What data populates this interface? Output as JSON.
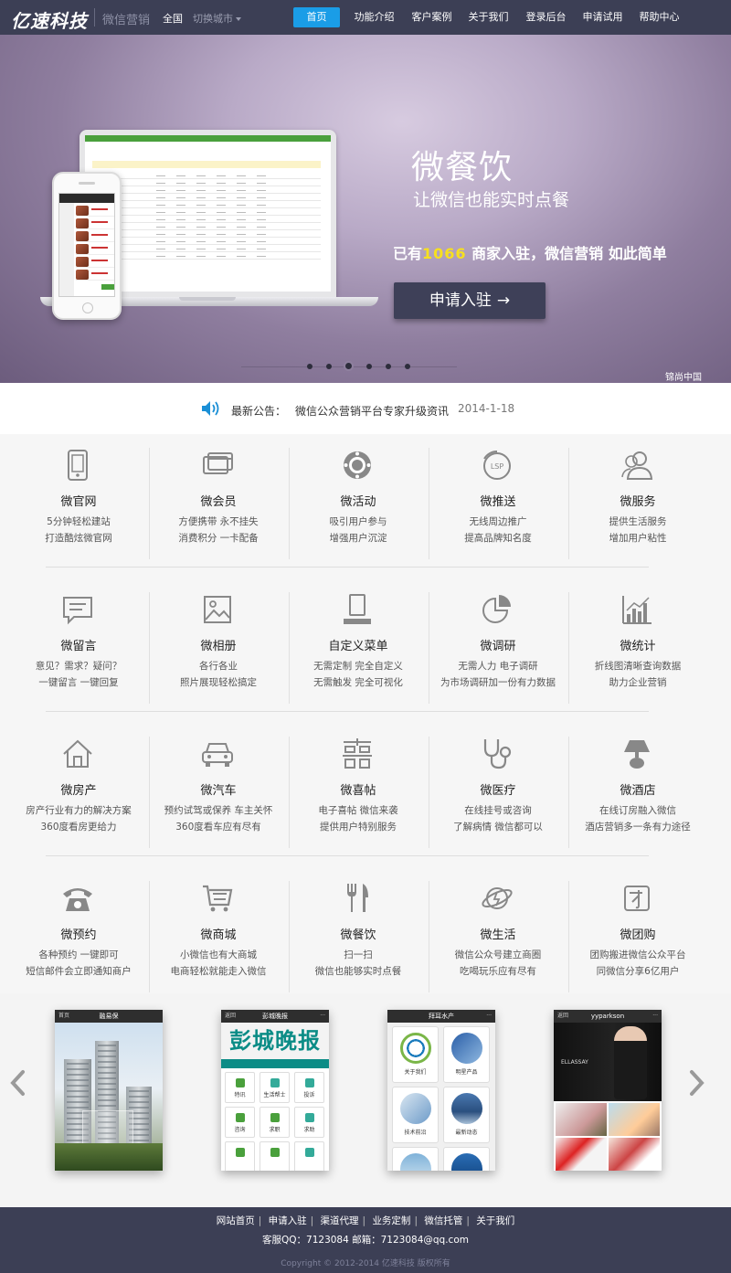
{
  "header": {
    "logo": "亿速科技",
    "sublogo": "微信营销",
    "city": "全国",
    "switch_city": "切换城市",
    "nav": [
      {
        "label": "首页",
        "active": true
      },
      {
        "label": "功能介绍"
      },
      {
        "label": "客户案例"
      },
      {
        "label": "关于我们"
      },
      {
        "label": "登录后台"
      },
      {
        "label": "申请试用"
      },
      {
        "label": "帮助中心"
      }
    ]
  },
  "banner": {
    "title": "微餐饮",
    "subtitle": "让微信也能实时点餐",
    "stat_prefix": "已有",
    "stat_number": "1066",
    "stat_suffix": " 商家入驻，微信营销 如此简单",
    "cta": "申请入驻",
    "cta_arrow": "→",
    "watermark": "锦尚中国",
    "slides": 6,
    "active_slide": 3
  },
  "notice": {
    "label": "最新公告：",
    "text": "微信公众营销平台专家升级资讯",
    "date": "2014-1-18"
  },
  "features": [
    [
      {
        "icon": "phone-icon",
        "name": "微官网",
        "l1": "5分钟轻松建站",
        "l2": "打造酷炫微官网"
      },
      {
        "icon": "card-icon",
        "name": "微会员",
        "l1": "方便携带 永不挂失",
        "l2": "消费积分 一卡配备"
      },
      {
        "icon": "gift-wheel-icon",
        "name": "微活动",
        "l1": "吸引用户参与",
        "l2": "增强用户沉淀"
      },
      {
        "icon": "lsp-icon",
        "name": "微推送",
        "l1": "无线周边推广",
        "l2": "提高品牌知名度"
      },
      {
        "icon": "users-icon",
        "name": "微服务",
        "l1": "提供生活服务",
        "l2": "增加用户粘性"
      }
    ],
    [
      {
        "icon": "message-icon",
        "name": "微留言",
        "l1": "意见？需求？疑问？",
        "l2": "一键留言  一键回复"
      },
      {
        "icon": "photo-icon",
        "name": "微相册",
        "l1": "各行各业",
        "l2": "照片展现轻松搞定"
      },
      {
        "icon": "menu-icon",
        "name": "自定义菜单",
        "l1": "无需定制 完全自定义",
        "l2": "无需触发 完全可视化"
      },
      {
        "icon": "pie-chart-icon",
        "name": "微调研",
        "l1": "无需人力 电子调研",
        "l2": "为市场调研加一份有力数据"
      },
      {
        "icon": "bar-chart-icon",
        "name": "微统计",
        "l1": "折线图清晰查询数据",
        "l2": "助力企业营销"
      }
    ],
    [
      {
        "icon": "house-icon",
        "name": "微房产",
        "l1": "房产行业有力的解决方案",
        "l2": "360度看房更给力"
      },
      {
        "icon": "car-icon",
        "name": "微汽车",
        "l1": "预约试驾或保养 车主关怀",
        "l2": "360度看车应有尽有"
      },
      {
        "icon": "double-happiness-icon",
        "name": "微喜帖",
        "l1": "电子喜帖 微信来袭",
        "l2": "提供用户特别服务"
      },
      {
        "icon": "stethoscope-icon",
        "name": "微医疗",
        "l1": "在线挂号或咨询",
        "l2": "了解病情 微信都可以"
      },
      {
        "icon": "lamp-icon",
        "name": "微酒店",
        "l1": "在线订房融入微信",
        "l2": "酒店营销多一条有力途径"
      }
    ],
    [
      {
        "icon": "telephone-icon",
        "name": "微预约",
        "l1": "各种预约 一键即可",
        "l2": "短信邮件会立即通知商户"
      },
      {
        "icon": "shopping-cart-icon",
        "name": "微商城",
        "l1": "小微信也有大商城",
        "l2": "电商轻松就能走入微信"
      },
      {
        "icon": "fork-knife-icon",
        "name": "微餐饮",
        "l1": "扫一扫",
        "l2": "微信也能够实时点餐"
      },
      {
        "icon": "planet-icon",
        "name": "微生活",
        "l1": "微信公众号建立商圈",
        "l2": "吃喝玩乐应有尽有"
      },
      {
        "icon": "group-buy-icon",
        "name": "微团购",
        "l1": "团购搬进微信公众平台",
        "l2": "同微信分享6亿用户"
      }
    ]
  ],
  "cases": {
    "items": [
      {
        "title": "融易保",
        "left": "首页",
        "right": ""
      },
      {
        "title": "彭城晚报",
        "left": "返回",
        "right": "···",
        "masthead": "彭城晚报",
        "cells": [
          "特讯",
          "生活帮士",
          "投诉",
          "咨询",
          "求职",
          "求助",
          "",
          "",
          ""
        ]
      },
      {
        "title": "拜耳水产",
        "left": "",
        "right": "···",
        "tiles": [
          "关于我们",
          "明星产品",
          "技术前沿",
          "最新动态",
          "",
          ""
        ]
      },
      {
        "title": "yyparkson",
        "left": "返回",
        "right": "···",
        "hero_text": "ELLASSAY"
      }
    ]
  },
  "footer": {
    "links": [
      "网站首页",
      "申请入驻",
      "渠道代理",
      "业务定制",
      "微信托管",
      "关于我们"
    ],
    "contact": "客服QQ：7123084    邮箱：7123084@qq.com",
    "copyright": "Copyright © 2012-2014 亿速科技 版权所有"
  },
  "colors": {
    "header_bg": "#3c3f55",
    "accent": "#1a9de7",
    "highlight": "#f7e01e",
    "cta_bg": "#3e4058"
  }
}
